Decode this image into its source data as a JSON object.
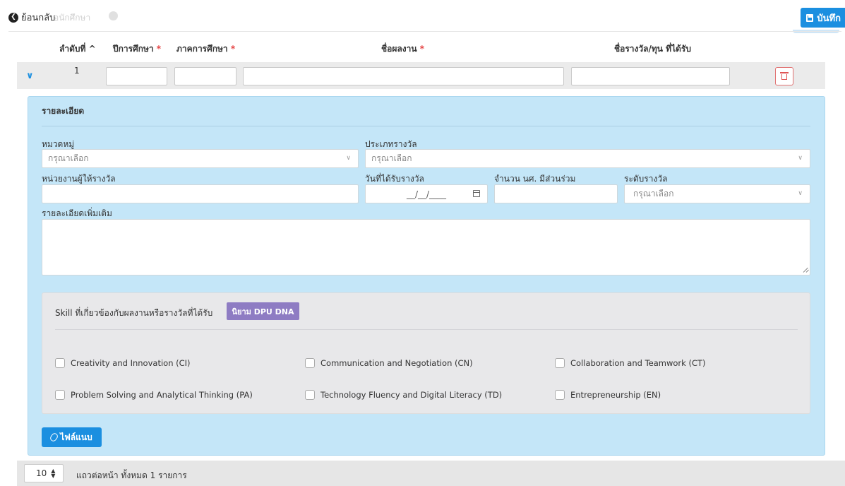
{
  "header": {
    "back_label": "ย้อนกลับ",
    "faded_label": "อนักศึกษา",
    "save_label": "บันทึก"
  },
  "table": {
    "columns": [
      {
        "label": "ลำดับที่ ^",
        "required": false
      },
      {
        "label": "ปีการศึกษา",
        "required": true
      },
      {
        "label": "ภาคการศึกษา",
        "required": true
      },
      {
        "label": "ชื่อผลงาน",
        "required": true
      },
      {
        "label": "ชื่อรางวัล/ทุน ที่ได้รับ",
        "required": false
      }
    ],
    "required_mark": "*",
    "rows": [
      {
        "number": "1",
        "year": "",
        "semester": "",
        "work_name": "",
        "award_name": ""
      }
    ]
  },
  "detail": {
    "title": "รายละเอียด",
    "category_label": "หมวดหมู่",
    "category_placeholder": "กรุณาเลือก",
    "award_type_label": "ประเภทรางวัล",
    "award_type_placeholder": "กรุณาเลือก",
    "agency_label": "หน่วยงานผู้ให้รางวัล",
    "agency_value": "",
    "date_label": "วันที่ได้รับรางวัล",
    "date_placeholder": "__/__/____",
    "participants_label": "จำนวน นศ. มีส่วนร่วม",
    "participants_value": "",
    "level_label": "ระดับรางวัล",
    "level_placeholder": "กรุณาเลือก",
    "more_detail_label": "รายละเอียดเพิ่มเติม",
    "more_detail_value": ""
  },
  "skills": {
    "title": "Skill ที่เกี่ยวข้องกับผลงานหรือรางวัลที่ได้รับ",
    "dna_button": "นิยาม DPU DNA",
    "items": [
      {
        "label": "Creativity and Innovation (CI)",
        "checked": false
      },
      {
        "label": "Communication and Negotiation (CN)",
        "checked": false
      },
      {
        "label": "Collaboration and Teamwork (CT)",
        "checked": false
      },
      {
        "label": "Problem Solving and Analytical Thinking (PA)",
        "checked": false
      },
      {
        "label": "Technology Fluency and Digital Literacy (TD)",
        "checked": false
      },
      {
        "label": "Entrepreneurship (EN)",
        "checked": false
      }
    ]
  },
  "attach_label": "ไฟล์แนบ",
  "footer": {
    "page_size": "10",
    "summary": "แถวต่อหน้า ทั้งหมด 1 รายการ"
  },
  "colors": {
    "primary": "#1b8fe0",
    "panel_bg": "#c4e6f8",
    "dna_purple": "#8e7cc3",
    "danger": "#e05555"
  }
}
